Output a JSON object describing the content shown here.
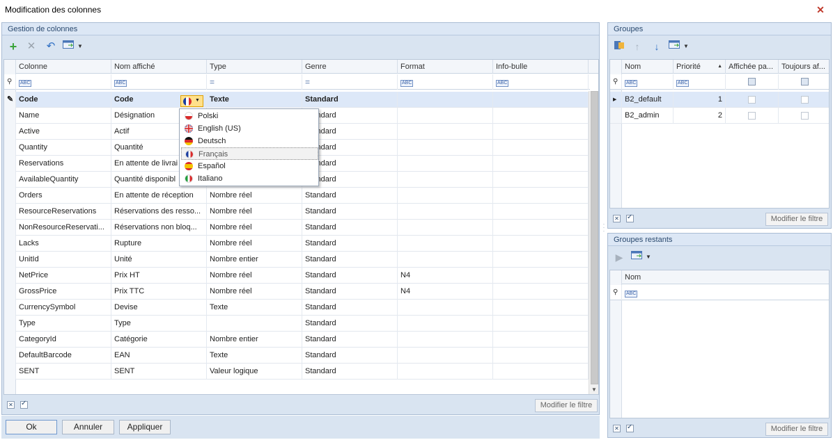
{
  "window": {
    "title": "Modification des colonnes"
  },
  "left_panel": {
    "title": "Gestion de colonnes",
    "columns": [
      "Colonne",
      "Nom affiché",
      "Type",
      "Genre",
      "Format",
      "Info-bulle"
    ],
    "filter_icon": "abc-filter-icon",
    "rows": [
      [
        "Code",
        "Code",
        "Texte",
        "Standard",
        "",
        ""
      ],
      [
        "Name",
        "Désignation",
        "",
        "Standard",
        "",
        ""
      ],
      [
        "Active",
        "Actif",
        "",
        "Standard",
        "",
        ""
      ],
      [
        "Quantity",
        "Quantité",
        "",
        "Standard",
        "",
        ""
      ],
      [
        "Reservations",
        "En attente de livrai",
        "",
        "Standard",
        "",
        ""
      ],
      [
        "AvailableQuantity",
        "Quantité disponibl",
        "",
        "Standard",
        "",
        ""
      ],
      [
        "Orders",
        "En attente de réception",
        "Nombre réel",
        "Standard",
        "",
        ""
      ],
      [
        "ResourceReservations",
        "Réservations des resso...",
        "Nombre réel",
        "Standard",
        "",
        ""
      ],
      [
        "NonResourceReservati...",
        "Réservations non bloq...",
        "Nombre réel",
        "Standard",
        "",
        ""
      ],
      [
        "Lacks",
        "Rupture",
        "Nombre réel",
        "Standard",
        "",
        ""
      ],
      [
        "UnitId",
        "Unité",
        "Nombre entier",
        "Standard",
        "",
        ""
      ],
      [
        "NetPrice",
        "Prix HT",
        "Nombre réel",
        "Standard",
        "N4",
        ""
      ],
      [
        "GrossPrice",
        "Prix TTC",
        "Nombre réel",
        "Standard",
        "N4",
        ""
      ],
      [
        "CurrencySymbol",
        "Devise",
        "Texte",
        "Standard",
        "",
        ""
      ],
      [
        "Type",
        "Type",
        "",
        "Standard",
        "",
        ""
      ],
      [
        "CategoryId",
        "Catégorie",
        "Nombre entier",
        "Standard",
        "",
        ""
      ],
      [
        "DefaultBarcode",
        "EAN",
        "Texte",
        "Standard",
        "",
        ""
      ],
      [
        "SENT",
        "SENT",
        "Valeur logique",
        "Standard",
        "",
        ""
      ]
    ],
    "language_dropdown": {
      "items": [
        "Polski",
        "English (US)",
        "Deutsch",
        "Français",
        "Español",
        "Italiano"
      ],
      "selected": "Français"
    },
    "modify_filter": "Modifier le filtre"
  },
  "groups_panel": {
    "title": "Groupes",
    "columns": [
      "Nom",
      "Priorité",
      "Affichée pa...",
      "Toujours af..."
    ],
    "rows": [
      {
        "name": "B2_default",
        "priority": "1"
      },
      {
        "name": "B2_admin",
        "priority": "2"
      }
    ],
    "modify_filter": "Modifier le filtre"
  },
  "remaining_panel": {
    "title": "Groupes restants",
    "columns": [
      "Nom"
    ],
    "modify_filter": "Modifier le filtre"
  },
  "buttons": {
    "ok": "Ok",
    "cancel": "Annuler",
    "apply": "Appliquer"
  },
  "colors": {
    "accent": "#2b4a6f",
    "panel_bg": "#d9e4f1",
    "selected_row": "#dde8f8"
  }
}
